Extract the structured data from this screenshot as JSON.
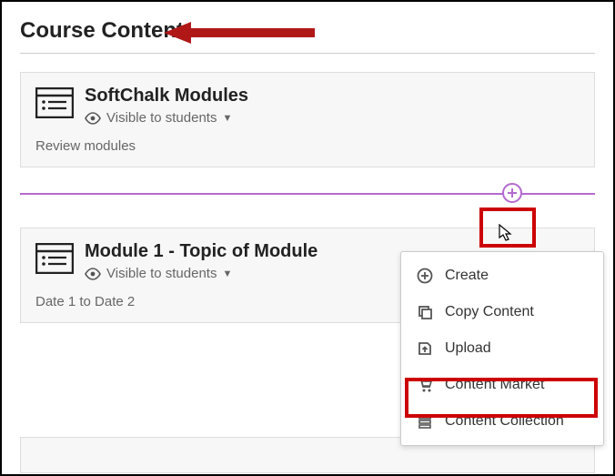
{
  "page_title": "Course Content",
  "modules": [
    {
      "title": "SoftChalk Modules",
      "visibility": "Visible to students",
      "description": "Review modules"
    },
    {
      "title": "Module 1 - Topic of Module",
      "visibility": "Visible to students",
      "description": "Date 1 to Date 2"
    }
  ],
  "add_menu": {
    "items": [
      {
        "icon": "plus-circle",
        "label": "Create"
      },
      {
        "icon": "copy",
        "label": "Copy Content"
      },
      {
        "icon": "upload",
        "label": "Upload"
      },
      {
        "icon": "cart",
        "label": "Content Market"
      },
      {
        "icon": "collection",
        "label": "Content Collection"
      }
    ]
  },
  "colors": {
    "accent_purple": "#b46ad0",
    "annotation_red": "#c00000"
  }
}
